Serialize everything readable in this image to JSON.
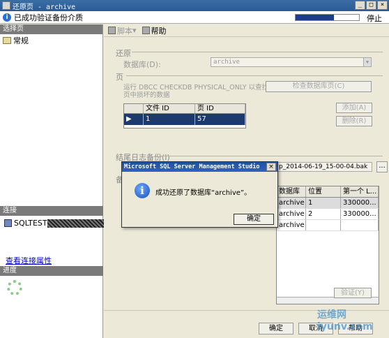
{
  "window": {
    "title": "还原页 - archive"
  },
  "status": {
    "text": "已成功验证备份介质",
    "stop": "停止",
    "progress": 0.6
  },
  "left": {
    "select_page": "选择页",
    "pages": [
      "常规"
    ],
    "connection": "连接",
    "server": "SQLTEST",
    "view_conn": "查看连接属性",
    "progress": "进度"
  },
  "toolbar": {
    "script": "脚本",
    "help": "帮助"
  },
  "restore_group": {
    "label": "还原",
    "db_label": "数据库(D):",
    "db_value": "archive"
  },
  "page_group": {
    "label": "页",
    "desc_line1": "运行 DBCC CHECKDB PHYSICAL_ONLY 以查找数据库",
    "desc_line2": "页中损坏的数据",
    "check_btn": "检查数据库页(C)",
    "add_btn": "添加(A)",
    "remove_btn": "删除(R)",
    "grid_cols": [
      "文件 ID",
      "页 ID"
    ],
    "grid_row": [
      "1",
      "57"
    ]
  },
  "tail_log": {
    "label": "结尾日志备份(I)",
    "path": "p_2014-06-19_15-00-04.bak",
    "browse": "..."
  },
  "backup_grid": {
    "label": "备",
    "cols": [
      "数据库",
      "位置",
      "第一个 L..."
    ],
    "rows": [
      [
        "archive",
        "1",
        "330000..."
      ],
      [
        "archive",
        "2",
        "330000..."
      ],
      [
        "archive",
        "",
        ""
      ]
    ]
  },
  "verify_btn": "验证(Y)",
  "bottom": {
    "ok": "确定",
    "cancel": "取消",
    "help": "帮助"
  },
  "dialog": {
    "title": "Microsoft SQL Server Management Studio",
    "close": "×",
    "message": "成功还原了数据库“archive”。",
    "ok": "确定"
  },
  "watermark": "运维网 iyunv.com"
}
